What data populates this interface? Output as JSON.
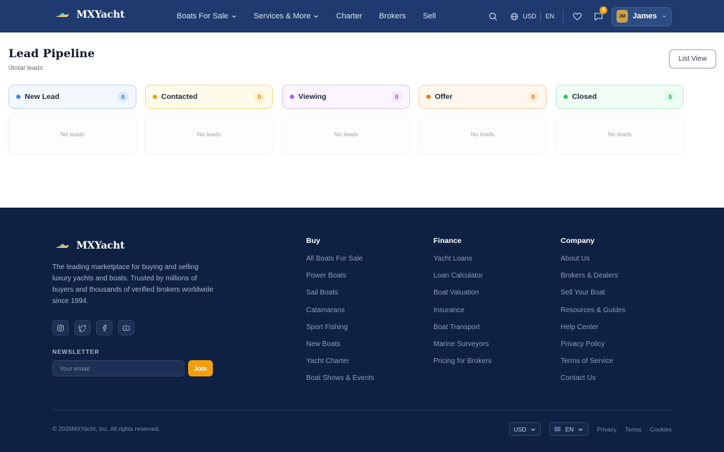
{
  "header": {
    "brand": "MXYacht",
    "nav": [
      {
        "label": "Boats For Sale",
        "dropdown": true
      },
      {
        "label": "Services & More",
        "dropdown": true
      },
      {
        "label": "Charter",
        "dropdown": false
      },
      {
        "label": "Brokers",
        "dropdown": false
      },
      {
        "label": "Sell",
        "dropdown": false
      }
    ],
    "currency": "USD",
    "language": "EN",
    "messages_badge": "3",
    "user": {
      "initials": "JM",
      "name": "James"
    }
  },
  "main": {
    "title": "Lead Pipeline",
    "lead_count": "0total leads",
    "list_view_label": "List View",
    "columns": [
      {
        "label": "New Lead",
        "count": "0",
        "empty_text": "No leads",
        "accent": "#3b82f6"
      },
      {
        "label": "Contacted",
        "count": "0",
        "empty_text": "No leads",
        "accent": "#f59e0b"
      },
      {
        "label": "Viewing",
        "count": "0",
        "empty_text": "No leads",
        "accent": "#a855f7"
      },
      {
        "label": "Offer",
        "count": "0",
        "empty_text": "No leads",
        "accent": "#f97316"
      },
      {
        "label": "Closed",
        "count": "0",
        "empty_text": "No leads",
        "accent": "#22c55e"
      }
    ]
  },
  "footer": {
    "brand": "MXYacht",
    "description": "The leading marketplace for buying and selling luxury yachts and boats. Trusted by millions of buyers and thousands of verified brokers worldwide since 1994.",
    "socials": [
      "instagram-icon",
      "twitter-icon",
      "facebook-icon",
      "youtube-icon"
    ],
    "newsletter_label": "NEWSLETTER",
    "newsletter_placeholder": "Your email",
    "newsletter_button": "Join",
    "columns": [
      {
        "title": "Buy",
        "links": [
          "All Boats For Sale",
          "Power Boats",
          "Sail Boats",
          "Catamarans",
          "Sport Fishing",
          "New Boats",
          "Yacht Charter",
          "Boat Shows & Events"
        ]
      },
      {
        "title": "Finance",
        "links": [
          "Yacht Loans",
          "Loan Calculator",
          "Boat Valuation",
          "Insurance",
          "Boat Transport",
          "Marine Surveyors",
          "Pricing for Brokers"
        ]
      },
      {
        "title": "Company",
        "links": [
          "About Us",
          "Brokers & Dealers",
          "Sell Your Boat",
          "Resources & Guides",
          "Help Center",
          "Privacy Policy",
          "Terms of Service",
          "Contact Us"
        ]
      }
    ],
    "copyright": "© 2026MXYacht, Inc. All rights reserved.",
    "currency_select": "USD",
    "language_select": "EN",
    "bottom_links": [
      "Privacy",
      "Terms",
      "Cookies"
    ]
  },
  "colors": {
    "header_bg": "#1e3a6e",
    "footer_bg": "#0f2142",
    "accent_orange": "#f59e0b"
  }
}
